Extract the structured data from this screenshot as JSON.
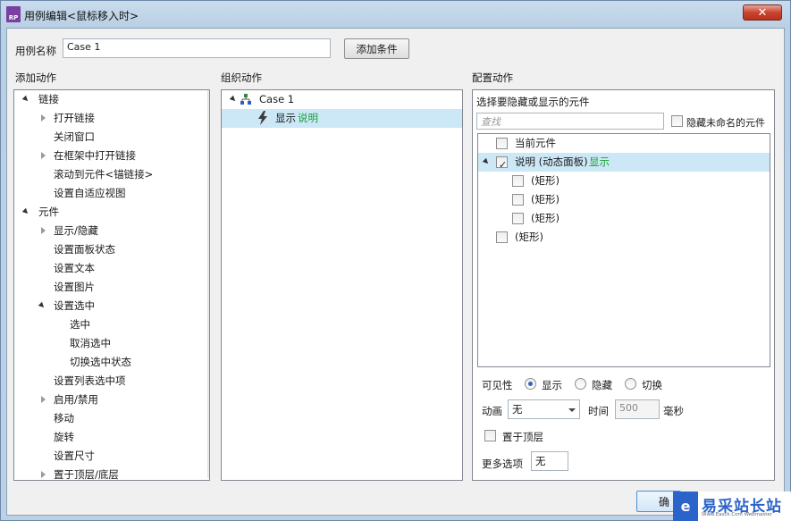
{
  "window": {
    "title": "用例编辑<鼠标移入时>",
    "app_badge": "RP",
    "close_glyph": "✕"
  },
  "case_name": {
    "label": "用例名称",
    "value": "Case 1",
    "add_condition": "添加条件"
  },
  "sections": {
    "add_action": "添加动作",
    "organize_action": "组织动作",
    "configure_action": "配置动作"
  },
  "action_tree": [
    {
      "label": "链接"
    },
    {
      "label": "打开链接"
    },
    {
      "label": "关闭窗口"
    },
    {
      "label": "在框架中打开链接"
    },
    {
      "label": "滚动到元件<锚链接>"
    },
    {
      "label": "设置自适应视图"
    },
    {
      "label": "元件"
    },
    {
      "label": "显示/隐藏"
    },
    {
      "label": "设置面板状态"
    },
    {
      "label": "设置文本"
    },
    {
      "label": "设置图片"
    },
    {
      "label": "设置选中"
    },
    {
      "label": "选中"
    },
    {
      "label": "取消选中"
    },
    {
      "label": "切换选中状态"
    },
    {
      "label": "设置列表选中项"
    },
    {
      "label": "启用/禁用"
    },
    {
      "label": "移动"
    },
    {
      "label": "旋转"
    },
    {
      "label": "设置尺寸"
    },
    {
      "label": "置于顶层/底层"
    }
  ],
  "organize": {
    "case_label": "Case 1",
    "action_verb": "显示",
    "action_target": "说明"
  },
  "configure": {
    "prompt": "选择要隐藏或显示的元件",
    "search_placeholder": "查找",
    "hide_unnamed_label": "隐藏未命名的元件",
    "hide_unnamed_checked": false,
    "widgets": [
      {
        "label": "当前元件",
        "checked": false
      },
      {
        "label": "说明 (动态面板)",
        "suffix": "显示",
        "checked": true
      },
      {
        "label": "(矩形)",
        "checked": false
      },
      {
        "label": "(矩形)",
        "checked": false
      },
      {
        "label": "(矩形)",
        "checked": false
      },
      {
        "label": "(矩形)",
        "checked": false
      }
    ],
    "visibility": {
      "label": "可见性",
      "options": [
        "显示",
        "隐藏",
        "切换"
      ],
      "selected": "显示"
    },
    "animation": {
      "label": "动画",
      "value": "无",
      "time_label": "时间",
      "time_value": "500",
      "unit": "毫秒"
    },
    "bring_to_front": {
      "label": "置于顶层",
      "checked": false
    },
    "more_options": {
      "label": "更多选项",
      "value": "无"
    }
  },
  "footer": {
    "ok_partial": "确"
  },
  "watermark": {
    "logo_glyph": "e",
    "title": "易采站长站",
    "subtitle": "Www.Easck.Com  Webmaster"
  },
  "colors": {
    "accent_green": "#16a035",
    "selection": "#cce8f6",
    "watermark_blue": "#2a63c9"
  }
}
